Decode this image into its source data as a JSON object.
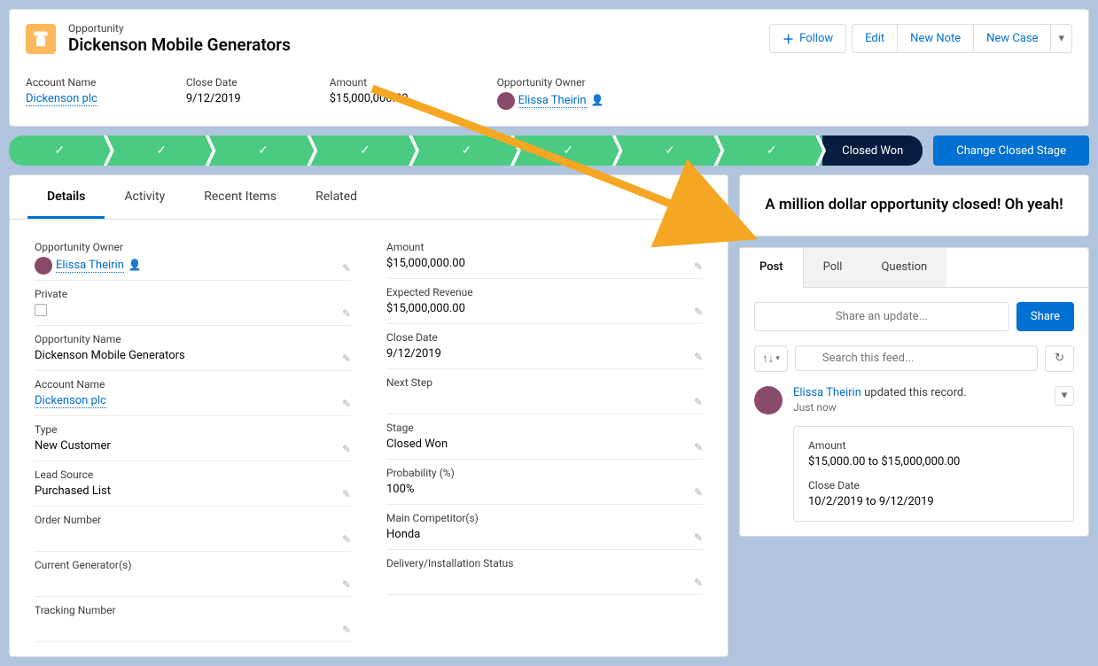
{
  "header": {
    "object_type": "Opportunity",
    "record_name": "Dickenson Mobile Generators",
    "actions": {
      "follow": "Follow",
      "edit": "Edit",
      "new_note": "New Note",
      "new_case": "New Case"
    }
  },
  "highlights": {
    "account_name": {
      "label": "Account Name",
      "value": "Dickenson plc"
    },
    "close_date": {
      "label": "Close Date",
      "value": "9/12/2019"
    },
    "amount": {
      "label": "Amount",
      "value": "$15,000,000.00"
    },
    "owner": {
      "label": "Opportunity Owner",
      "value": "Elissa Theirin"
    }
  },
  "path": {
    "current_stage": "Closed Won",
    "change_button": "Change Closed Stage"
  },
  "tabs": [
    "Details",
    "Activity",
    "Recent Items",
    "Related"
  ],
  "active_tab": 0,
  "details": {
    "left": [
      {
        "label": "Opportunity Owner",
        "value": "Elissa Theirin",
        "is_link": true,
        "has_avatar": true
      },
      {
        "label": "Private",
        "value": "",
        "is_checkbox": true
      },
      {
        "label": "Opportunity Name",
        "value": "Dickenson Mobile Generators"
      },
      {
        "label": "Account Name",
        "value": "Dickenson plc",
        "is_link": true
      },
      {
        "label": "Type",
        "value": "New Customer"
      },
      {
        "label": "Lead Source",
        "value": "Purchased List"
      },
      {
        "label": "Order Number",
        "value": ""
      },
      {
        "label": "Current Generator(s)",
        "value": ""
      },
      {
        "label": "Tracking Number",
        "value": ""
      }
    ],
    "right": [
      {
        "label": "Amount",
        "value": "$15,000,000.00"
      },
      {
        "label": "Expected Revenue",
        "value": "$15,000,000.00"
      },
      {
        "label": "Close Date",
        "value": "9/12/2019"
      },
      {
        "label": "Next Step",
        "value": ""
      },
      {
        "label": "Stage",
        "value": "Closed Won"
      },
      {
        "label": "Probability (%)",
        "value": "100%"
      },
      {
        "label": "Main Competitor(s)",
        "value": "Honda"
      },
      {
        "label": "Delivery/Installation Status",
        "value": ""
      }
    ]
  },
  "chatter": {
    "highlight": "A million dollar opportunity closed! Oh yeah!",
    "tabs": [
      "Post",
      "Poll",
      "Question"
    ],
    "share_placeholder": "Share an update...",
    "share_button": "Share",
    "search_placeholder": "Search this feed...",
    "feed_item": {
      "author": "Elissa Theirin",
      "action_text": " updated this record.",
      "time": "Just now",
      "changes": [
        {
          "label": "Amount",
          "value": "$15,000.00 to $15,000,000.00"
        },
        {
          "label": "Close Date",
          "value": "10/2/2019 to 9/12/2019"
        }
      ]
    }
  }
}
